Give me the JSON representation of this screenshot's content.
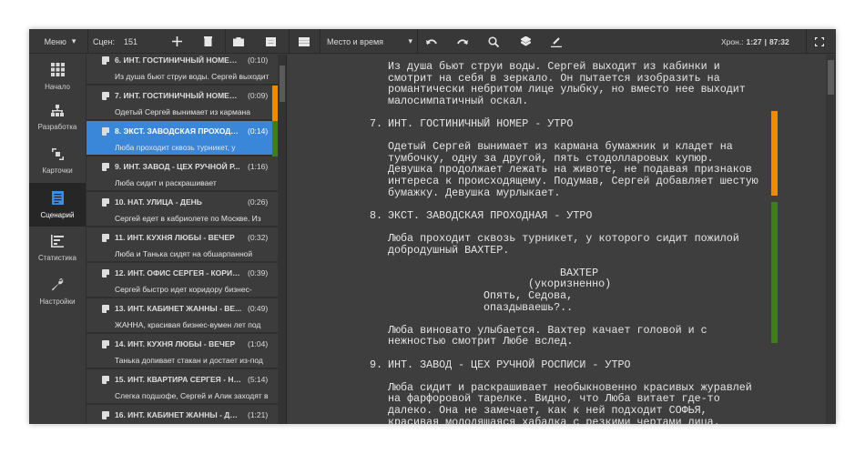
{
  "toolbar": {
    "menu": "Меню",
    "scenes_label": "Сцен:",
    "scenes_count": "151",
    "scene_filter": "Место и время",
    "chrono_label": "Хрон.:",
    "chrono_current": "1:27",
    "chrono_total": "87:32",
    "icons": [
      "plus-icon",
      "trash-icon",
      "briefcase-icon",
      "card-icon",
      "list-icon",
      "undo-icon",
      "redo-icon",
      "search-icon",
      "layers-icon",
      "pen-icon",
      "fullscreen-icon"
    ]
  },
  "sidebar": {
    "items": [
      {
        "label": "Начало",
        "icon": "grid-icon"
      },
      {
        "label": "Разработка",
        "icon": "hierarchy-icon"
      },
      {
        "label": "Карточки",
        "icon": "cards-icon"
      },
      {
        "label": "Сценарий",
        "icon": "document-icon",
        "active": true
      },
      {
        "label": "Статистика",
        "icon": "stats-icon"
      },
      {
        "label": "Настройки",
        "icon": "wrench-icon"
      }
    ]
  },
  "colors": {
    "accent": "#3a86d8",
    "orange": "#f08a00",
    "green": "#3f7d1e"
  },
  "scenes": [
    {
      "title": "6. ИНТ. ГОСТИНИЧНЫЙ НОМЕР ...",
      "dur": "(0:10)",
      "summary": "Из душа бьют струи воды. Сергей выходит"
    },
    {
      "title": "7. ИНТ. ГОСТИНИЧНЫЙ НОМЕР ...",
      "dur": "(0:09)",
      "summary": "Одетый Сергей вынимает из кармана",
      "color": "#f08a00"
    },
    {
      "title": "8. ЭКСТ. ЗАВОДСКАЯ ПРОХОДН...",
      "dur": "(0:14)",
      "summary": "Люба проходит сквозь турникет, у",
      "color": "#3f7d1e",
      "selected": true
    },
    {
      "title": "9. ИНТ. ЗАВОД - ЦЕХ РУЧНОЙ Р...",
      "dur": "(1:16)",
      "summary": "Люба сидит и раскрашивает"
    },
    {
      "title": "10. НАТ. УЛИЦА - ДЕНЬ",
      "dur": "(0:26)",
      "summary": "Сергей едет в кабриолете по Москве. Из"
    },
    {
      "title": "11. ИНТ. КУХНЯ ЛЮБЫ - ВЕЧЕР",
      "dur": "(0:32)",
      "summary": "Люба и Танька сидят на обшарпанной"
    },
    {
      "title": "12. ИНТ. ОФИС СЕРГЕЯ - КОРИД...",
      "dur": "(0:39)",
      "summary": "Сергей быстро идет коридору бизнес-"
    },
    {
      "title": "13. ИНТ. КАБИНЕТ ЖАННЫ - ВЕ...",
      "dur": "(0:49)",
      "summary": "ЖАННА, красивая бизнес-вумен лет под"
    },
    {
      "title": "14. ИНТ. КУХНЯ ЛЮБЫ - ВЕЧЕР",
      "dur": "(1:04)",
      "summary": "Танька допивает стакан и достает из-под"
    },
    {
      "title": "15. ИНТ. КВАРТИРА СЕРГЕЯ - НО...",
      "dur": "(5:14)",
      "summary": "Слегка подшофе, Сергей и Алик заходят в"
    },
    {
      "title": "16. ИНТ. КАБИНЕТ ЖАННЫ - ДЕНЬ",
      "dur": "(1:21)",
      "summary": ""
    }
  ],
  "script": [
    {
      "type": "action",
      "lines": [
        "Из душа бьют струи воды. Сергей выходит из кабинки и",
        "смотрит на себя в зеркало. Он пытается изобразить на",
        "романтически небритом лице улыбку, но вместо нее выходит",
        "малосимпатичный оскал."
      ]
    },
    {
      "type": "heading",
      "num": "7.",
      "text": "ИНТ. ГОСТИНИЧНЫЙ НОМЕР - УТРО"
    },
    {
      "type": "action",
      "lines": [
        "Одетый Сергей вынимает из кармана бумажник и кладет на",
        "тумбочку, одну за другой, пять стодолларовых купюр.",
        "Девушка продолжает лежать на животе, не подавая признаков",
        "интереса к происходящему. Подумав, Сергей добавляет шестую",
        "бумажку. Девушка мурлыкает."
      ]
    },
    {
      "type": "heading",
      "num": "8.",
      "text": "ЭКСТ. ЗАВОДСКАЯ ПРОХОДНАЯ - УТРО"
    },
    {
      "type": "action",
      "lines": [
        "Люба проходит сквозь турникет, у которого сидит пожилой",
        "добродушный ВАХТЕР."
      ]
    },
    {
      "type": "character",
      "text": "ВАХТЕР"
    },
    {
      "type": "parenthetical",
      "text": "(укоризненно)"
    },
    {
      "type": "dialogue",
      "lines": [
        "Опять, Седова,",
        "опаздываешь?.."
      ]
    },
    {
      "type": "action",
      "lines": [
        "Люба виновато улыбается. Вахтер качает головой и с",
        "нежностью смотрит Любе вслед."
      ]
    },
    {
      "type": "heading",
      "num": "9.",
      "text": "ИНТ. ЗАВОД - ЦЕХ РУЧНОЙ РОСПИСИ - УТРО"
    },
    {
      "type": "action",
      "lines": [
        "Люба сидит и раскрашивает необыкновенно красивых журавлей",
        "на фарфоровой тарелке. Видно, что Люба витает где-то",
        "далеко. Она не замечает, как к ней подходит СОФЬЯ,",
        "красивая молодящаяся хабалка с резкими чертами лица."
      ]
    }
  ]
}
